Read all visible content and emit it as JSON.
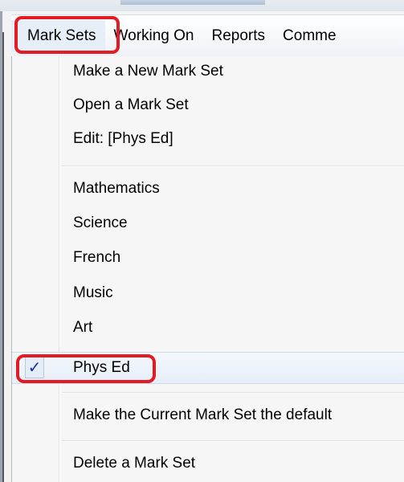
{
  "menubar": {
    "items": [
      {
        "label": "Mark Sets"
      },
      {
        "label": "Working On"
      },
      {
        "label": "Reports"
      },
      {
        "label": "Comme"
      }
    ]
  },
  "dropdown": {
    "group1": [
      {
        "label": "Make a New Mark Set"
      },
      {
        "label": "Open a Mark Set"
      },
      {
        "label": "Edit: [Phys Ed]"
      }
    ],
    "group2": [
      {
        "label": "Mathematics"
      },
      {
        "label": "Science"
      },
      {
        "label": "French"
      },
      {
        "label": "Music"
      },
      {
        "label": "Art"
      },
      {
        "label": "Phys Ed",
        "checked": true
      }
    ],
    "group3": [
      {
        "label": "Make the Current Mark Set the default"
      }
    ],
    "group4": [
      {
        "label": "Delete a Mark Set"
      }
    ],
    "check_glyph": "✓"
  },
  "colors": {
    "highlight_outline": "#e31b23",
    "checked_row_bg": "#e6eef7"
  }
}
